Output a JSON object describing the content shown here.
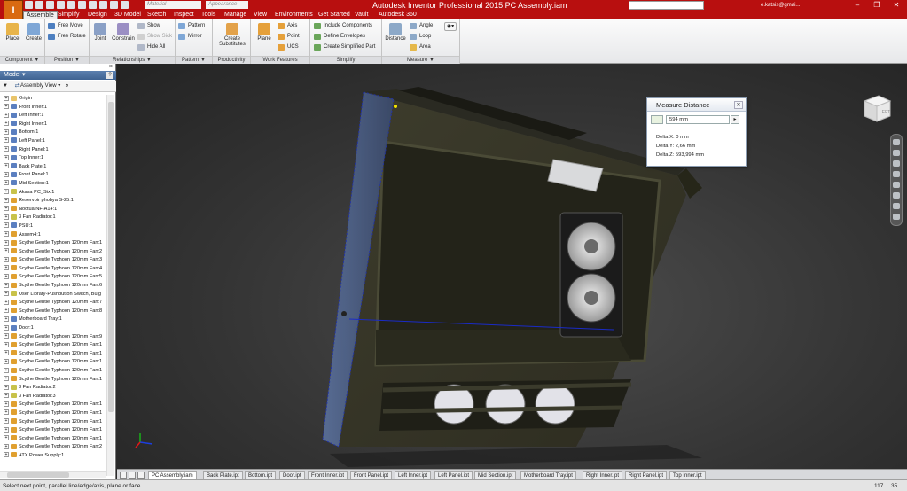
{
  "app": {
    "title": "Autodesk Inventor Professional 2015   PC Assembly.iam",
    "logo_letter": "I",
    "material_placeholder": "Material",
    "appearance_placeholder": "Appearance",
    "user": "e.katsis@gmai...",
    "accent_color": "#b80f0f"
  },
  "menu_tabs": [
    "Assemble",
    "Simplify",
    "Design",
    "3D Model",
    "Sketch",
    "Inspect",
    "Tools",
    "Manage",
    "View",
    "Environments",
    "Get Started",
    "Vault",
    "Autodesk 360"
  ],
  "ribbon": {
    "groups": {
      "component": "Component ▼",
      "position": "Position ▼",
      "relationships": "Relationships ▼",
      "pattern": "Pattern ▼",
      "productivity": "Productivity",
      "work_features": "Work Features",
      "simplify": "Simplify",
      "measure": "Measure ▼"
    },
    "buttons": {
      "place": "Place",
      "create": "Create",
      "free_move": "Free Move",
      "free_rotate": "Free Rotate",
      "joint": "Joint",
      "constrain": "Constrain",
      "show": "Show",
      "show_sick": "Show Sick",
      "hide_all": "Hide All",
      "pattern": "Pattern",
      "mirror": "Mirror",
      "create_substitutes_1": "Create",
      "create_substitutes_2": "Substitutes",
      "plane": "Plane",
      "axis": "Axis",
      "point": "Point",
      "ucs": "UCS",
      "include_components": "Include Components",
      "define_envelopes": "Define Envelopes",
      "create_simplified_part": "Create Simplified Part",
      "distance": "Distance",
      "angle": "Angle",
      "loop": "Loop",
      "area": "Area"
    }
  },
  "browser": {
    "header": "Model ▾",
    "view_label": "Assembly View",
    "items": [
      {
        "label": "Origin",
        "kind": "folder"
      },
      {
        "label": "Front Inner:1",
        "kind": "part"
      },
      {
        "label": "Left Inner:1",
        "kind": "part"
      },
      {
        "label": "Right Inner:1",
        "kind": "part"
      },
      {
        "label": "Bottom:1",
        "kind": "part"
      },
      {
        "label": "Left Panel:1",
        "kind": "part"
      },
      {
        "label": "Right Panel:1",
        "kind": "part"
      },
      {
        "label": "Top Inner:1",
        "kind": "part"
      },
      {
        "label": "Back Plate:1",
        "kind": "part"
      },
      {
        "label": "Front Panel:1",
        "kind": "part"
      },
      {
        "label": "Mid Section:1",
        "kind": "part"
      },
      {
        "label": "Akasa PC_Six:1",
        "kind": "sub"
      },
      {
        "label": "Reservoir phobya S-25:1",
        "kind": "asm"
      },
      {
        "label": "Noctua NF-A14:1",
        "kind": "asm"
      },
      {
        "label": "3 Fan Radiator:1",
        "kind": "sub"
      },
      {
        "label": "PSU:1",
        "kind": "part"
      },
      {
        "label": "Assem4:1",
        "kind": "asm"
      },
      {
        "label": "Scythe Gentle Typhoon 120mm Fan:1",
        "kind": "asm"
      },
      {
        "label": "Scythe Gentle Typhoon 120mm Fan:2",
        "kind": "asm"
      },
      {
        "label": "Scythe Gentle Typhoon 120mm Fan:3",
        "kind": "asm"
      },
      {
        "label": "Scythe Gentle Typhoon 120mm Fan:4",
        "kind": "asm"
      },
      {
        "label": "Scythe Gentle Typhoon 120mm Fan:5",
        "kind": "asm"
      },
      {
        "label": "Scythe Gentle Typhoon 120mm Fan:6",
        "kind": "asm"
      },
      {
        "label": "User Library-Pushbutton Switch, Bulg",
        "kind": "sub"
      },
      {
        "label": "Scythe Gentle Typhoon 120mm Fan:7",
        "kind": "asm"
      },
      {
        "label": "Scythe Gentle Typhoon 120mm Fan:8",
        "kind": "asm"
      },
      {
        "label": "Motherboard Tray:1",
        "kind": "part"
      },
      {
        "label": "Door:1",
        "kind": "part"
      },
      {
        "label": "Scythe Gentle Typhoon 120mm Fan:9",
        "kind": "asm"
      },
      {
        "label": "Scythe Gentle Typhoon 120mm Fan:1",
        "kind": "asm"
      },
      {
        "label": "Scythe Gentle Typhoon 120mm Fan:1",
        "kind": "asm"
      },
      {
        "label": "Scythe Gentle Typhoon 120mm Fan:1",
        "kind": "asm"
      },
      {
        "label": "Scythe Gentle Typhoon 120mm Fan:1",
        "kind": "asm"
      },
      {
        "label": "Scythe Gentle Typhoon 120mm Fan:1",
        "kind": "asm"
      },
      {
        "label": "3 Fan Radiator:2",
        "kind": "sub"
      },
      {
        "label": "3 Fan Radiator:3",
        "kind": "sub"
      },
      {
        "label": "Scythe Gentle Typhoon 120mm Fan:1",
        "kind": "asm"
      },
      {
        "label": "Scythe Gentle Typhoon 120mm Fan:1",
        "kind": "asm"
      },
      {
        "label": "Scythe Gentle Typhoon 120mm Fan:1",
        "kind": "asm"
      },
      {
        "label": "Scythe Gentle Typhoon 120mm Fan:1",
        "kind": "asm"
      },
      {
        "label": "Scythe Gentle Typhoon 120mm Fan:1",
        "kind": "asm"
      },
      {
        "label": "Scythe Gentle Typhoon 120mm Fan:2",
        "kind": "asm"
      },
      {
        "label": "ATX Power Supply:1",
        "kind": "asm"
      }
    ]
  },
  "measure": {
    "title": "Measure Distance",
    "value": "594 mm",
    "delta_x": "Delta X: 0 mm",
    "delta_y": "Delta Y: 2,66 mm",
    "delta_z": "Delta Z: 593,994 mm"
  },
  "viewcube_label": "LEFT",
  "doc_tabs": [
    "PC Assembly.iam",
    "Back Plate.ipt",
    "Bottom.ipt",
    "Door.ipt",
    "Front Inner.ipt",
    "Front Panel.ipt",
    "Left Inner.ipt",
    "Left Panel.ipt",
    "Mid Section.ipt",
    "Motherboard Tray.ipt",
    "Right Inner.ipt",
    "Right Panel.ipt",
    "Top Inner.ipt"
  ],
  "status": {
    "prompt": "Select next point, parallel line/edge/axis, plane or face",
    "num1": "117",
    "num2": "35"
  }
}
